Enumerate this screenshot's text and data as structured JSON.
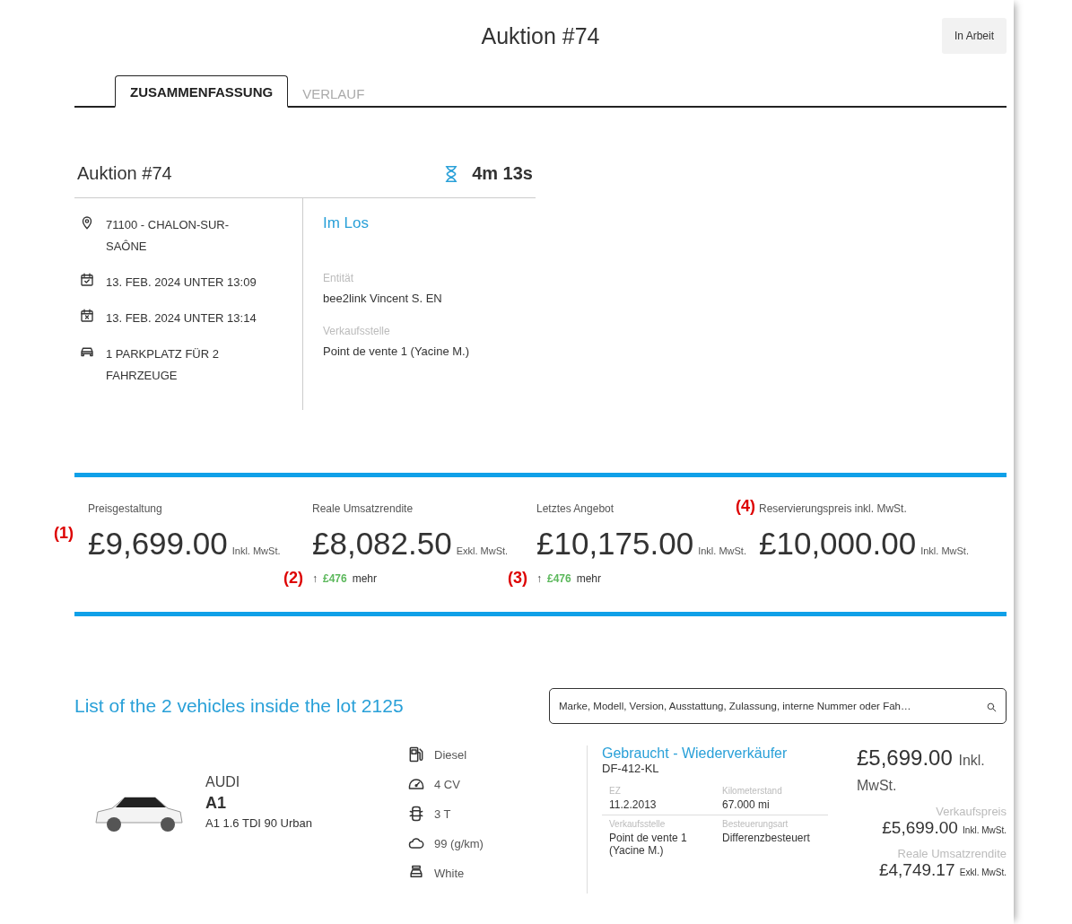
{
  "header": {
    "title": "Auktion #74",
    "status": "In Arbeit"
  },
  "tabs": [
    {
      "label": "ZUSAMMENFASSUNG",
      "selected": true
    },
    {
      "label": "VERLAUF",
      "selected": false
    }
  ],
  "summary": {
    "title": "Auktion #74",
    "timer": "4m 13s",
    "details": [
      {
        "kind": "location",
        "text": "71100 - CHALON-SUR-SAÔNE"
      },
      {
        "kind": "start",
        "text": "13. FEB. 2024 UNTER 13:09"
      },
      {
        "kind": "end",
        "text": "13. FEB. 2024 UNTER 13:14"
      },
      {
        "kind": "parking",
        "text": "1 PARKPLATZ FÜR 2 FAHRZEUGE"
      }
    ],
    "lot_label": "Im Los",
    "fields": [
      {
        "label": "Entität",
        "value": "bee2link Vincent S. EN"
      },
      {
        "label": "Verkaufsstelle",
        "value": "Point de vente 1 (Yacine M.)"
      }
    ]
  },
  "prices": [
    {
      "marker": {
        "text": "(1)",
        "kind": "value"
      },
      "label": "Preisgestaltung",
      "value": "£9,699.00",
      "tax": "Inkl. MwSt."
    },
    {
      "marker": {
        "text": "(2)",
        "kind": "delta"
      },
      "label": "Reale Umsatzrendite",
      "value": "£8,082.50",
      "tax": "Exkl. MwSt.",
      "delta": {
        "arrow": "↑",
        "amount": "£476",
        "suffix": "mehr"
      }
    },
    {
      "marker": {
        "text": "(3)",
        "kind": "delta"
      },
      "label": "Letztes Angebot",
      "value": "£10,175.00",
      "tax": "Inkl. MwSt.",
      "delta": {
        "arrow": "↑",
        "amount": "£476",
        "suffix": "mehr"
      }
    },
    {
      "marker": {
        "text": "(4)",
        "kind": "label"
      },
      "label": "Reservierungspreis inkl. MwSt.",
      "value": "£10,000.00",
      "tax": "Inkl. MwSt."
    }
  ],
  "vehicles_section": {
    "title": "List of the 2 vehicles inside the lot 2125",
    "search": {
      "placeholder": "Marke, Modell, Version, Ausstattung, Zulassung, interne Nummer oder Fah…"
    }
  },
  "vehicles": [
    {
      "make": "AUDI",
      "model": "A1",
      "version": "A1 1.6 TDI 90 Urban",
      "specs": [
        {
          "kind": "fuel",
          "text": "Diesel"
        },
        {
          "kind": "power",
          "text": "4 CV"
        },
        {
          "kind": "seats",
          "text": "3 T"
        },
        {
          "kind": "co2",
          "text": "99 (g/km)"
        },
        {
          "kind": "color",
          "text": "White"
        }
      ],
      "condition": "Gebraucht - Wiederverkäufer",
      "plate": "DF-412-KL",
      "facts": [
        {
          "label": "EZ",
          "value": "11.2.2013"
        },
        {
          "label": "Kilometerstand",
          "value": "67.000 mi"
        },
        {
          "label": "Verkaufsstelle",
          "value": "Point de vente 1 (Yacine M.)"
        },
        {
          "label": "Besteuerungsart",
          "value": "Differenzbesteuert"
        }
      ],
      "price": {
        "value": "£5,699.00",
        "tax": "Inkl. MwSt."
      },
      "sub_prices": [
        {
          "label": "Verkaufspreis",
          "value": "£5,699.00",
          "tax": "Inkl. MwSt."
        },
        {
          "label": "Reale Umsatzrendite",
          "value": "£4,749.17",
          "tax": "Exkl. MwSt."
        }
      ]
    }
  ]
}
